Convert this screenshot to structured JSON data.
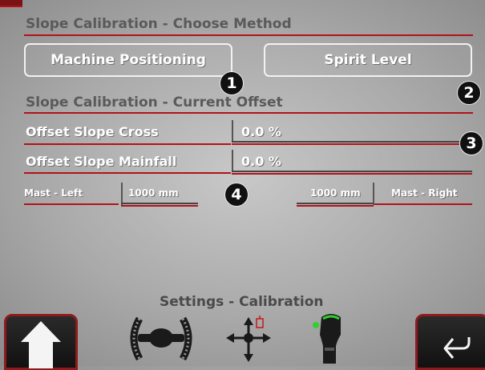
{
  "choose_method": {
    "title": "Slope Calibration - Choose Method",
    "buttons": [
      {
        "label": "Machine Positioning",
        "badge": "1"
      },
      {
        "label": "Spirit Level",
        "badge": "2"
      }
    ]
  },
  "current_offset": {
    "title": "Slope Calibration - Current Offset",
    "rows": [
      {
        "label": "Offset Slope Cross",
        "value": "0.0 %"
      },
      {
        "label": "Offset Slope Mainfall",
        "value": "0.0 %"
      }
    ],
    "badge": "3"
  },
  "mast": {
    "left_label": "Mast - Left",
    "left_value": "1000 mm",
    "right_label": "Mast - Right",
    "right_value": "1000 mm",
    "badge": "4"
  },
  "footer": {
    "title": "Settings - Calibration",
    "icons": [
      "home-icon",
      "axle-slope-icon",
      "move-arrows-icon",
      "joystick-icon",
      "back-icon"
    ]
  },
  "colors": {
    "accent_red": "#b3121a",
    "badge_bg": "#111111",
    "nav_border": "#8e1a1e"
  }
}
